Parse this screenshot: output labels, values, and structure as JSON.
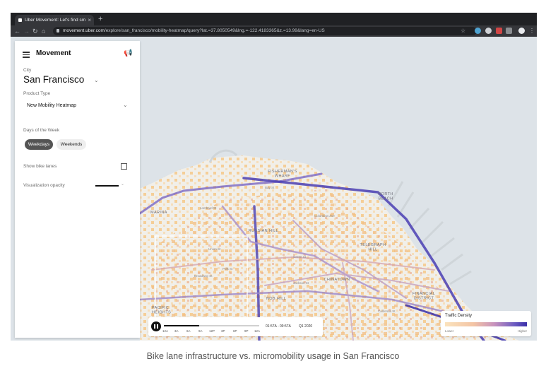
{
  "browser": {
    "tab_title": "Uber Movement: Let's find sm",
    "tab_close": "×",
    "new_tab": "+",
    "url_host": "movement.uber.com",
    "url_path": "/explore/san_francisco/mobility-heatmap/query?lat.=37.8050549&lng.=-122.4183365&z.=13.99&lang=en-US"
  },
  "panel": {
    "brand": "Movement",
    "city_label": "City",
    "city": "San Francisco",
    "product_label": "Product Type",
    "product": "New Mobility Heatmap",
    "days_label": "Days of the Week",
    "days": [
      "Weekdays",
      "Weekends"
    ],
    "selected_day": "Weekdays",
    "bike_lanes_label": "Show bike lanes",
    "bike_lanes_checked": false,
    "opacity_label": "Visualization opacity"
  },
  "map": {
    "labels": [
      {
        "name": "map-label-fishermans-wharf",
        "text": "FISHERMAN'S\nWHARF"
      },
      {
        "name": "map-label-north-beach",
        "text": "NORTH\nBEACH"
      },
      {
        "name": "map-label-marina",
        "text": "MARINA"
      },
      {
        "name": "map-label-russian-hill",
        "text": "RUSSIAN HILL"
      },
      {
        "name": "map-label-telegraph-hill",
        "text": "TELEGRAPH\nHILL"
      },
      {
        "name": "map-label-chinatown",
        "text": "CHINATOWN"
      },
      {
        "name": "map-label-nob-hill",
        "text": "NOB HILL"
      },
      {
        "name": "map-label-financial-district",
        "text": "FINANCIAL\nDISTRICT"
      },
      {
        "name": "map-label-pacific-heights",
        "text": "PACIFIC\nHEIGHTS"
      }
    ],
    "street_labels": [
      "Bay St",
      "Lombard St",
      "Union St",
      "Green St",
      "Broadway St",
      "Columbus Ave",
      "Jackson St",
      "Polk St",
      "California St"
    ]
  },
  "timeline": {
    "ticks": [
      "12A",
      "3A",
      "6A",
      "9A",
      "12P",
      "3P",
      "6P",
      "9P",
      "12A"
    ],
    "range": "01:57A - 09:57A",
    "quarter": "Q1 2020"
  },
  "legend": {
    "title": "Traffic Density",
    "low": "Lower",
    "high": "Higher"
  },
  "caption": "Bike lane infrastructure vs. micromobility usage in San Francisco",
  "colors": {
    "water": "#dde3e8",
    "land": "#f1f0ec",
    "heat_low": "#f8d8a8",
    "heat_high": "#3a2fa8",
    "accent_dark": "#545454"
  }
}
